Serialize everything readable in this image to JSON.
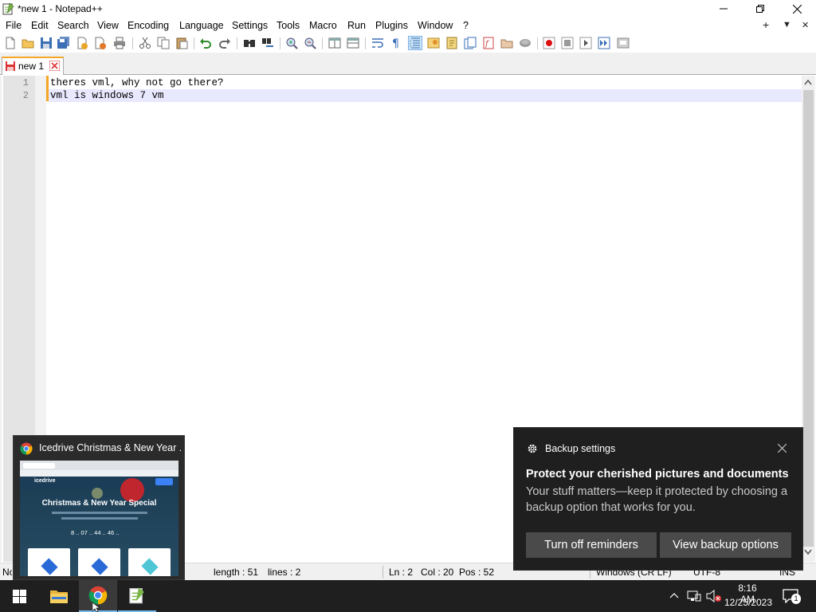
{
  "window": {
    "title": "*new 1 - Notepad++"
  },
  "menu": {
    "items": [
      "File",
      "Edit",
      "Search",
      "View",
      "Encoding",
      "Language",
      "Settings",
      "Tools",
      "Macro",
      "Run",
      "Plugins",
      "Window",
      "?"
    ],
    "right_plus": "+",
    "right_down": "▼",
    "right_close": "✕"
  },
  "tabs": [
    {
      "label": "new 1",
      "modified": true
    }
  ],
  "editor": {
    "lines": [
      {
        "number": "1",
        "text": "theres vml, why not go there?"
      },
      {
        "number": "2",
        "text": "vml is windows 7 vm"
      }
    ]
  },
  "status": {
    "left": "Normal text file",
    "length": "length : 51",
    "lines": "lines : 2",
    "ln": "Ln : 2",
    "col": "Col : 20",
    "pos": "Pos : 52",
    "eol": "Windows (CR LF)",
    "encoding": "UTF-8",
    "mode": "INS"
  },
  "preview": {
    "title": "Icedrive Christmas & New Year ...",
    "page_brand": "icedrive",
    "page_heading": "Christmas & New Year Special",
    "page_countdown": "8 .. 07 .. 44 .. 46 .."
  },
  "toast": {
    "app": "Backup settings",
    "heading": "Protect your cherished pictures and documents",
    "body": "Your stuff matters—keep it protected by choosing a backup option that works for you.",
    "btn1": "Turn off reminders",
    "btn2": "View backup options"
  },
  "tray": {
    "time": "8:16 AM",
    "date": "12/25/2023",
    "notif_count": "1"
  },
  "colors": {
    "accent": "#f5a623",
    "current_line": "#e8e8ff",
    "toast_bg": "#1f1f1f",
    "taskbar_bg": "#1f1f1f"
  }
}
